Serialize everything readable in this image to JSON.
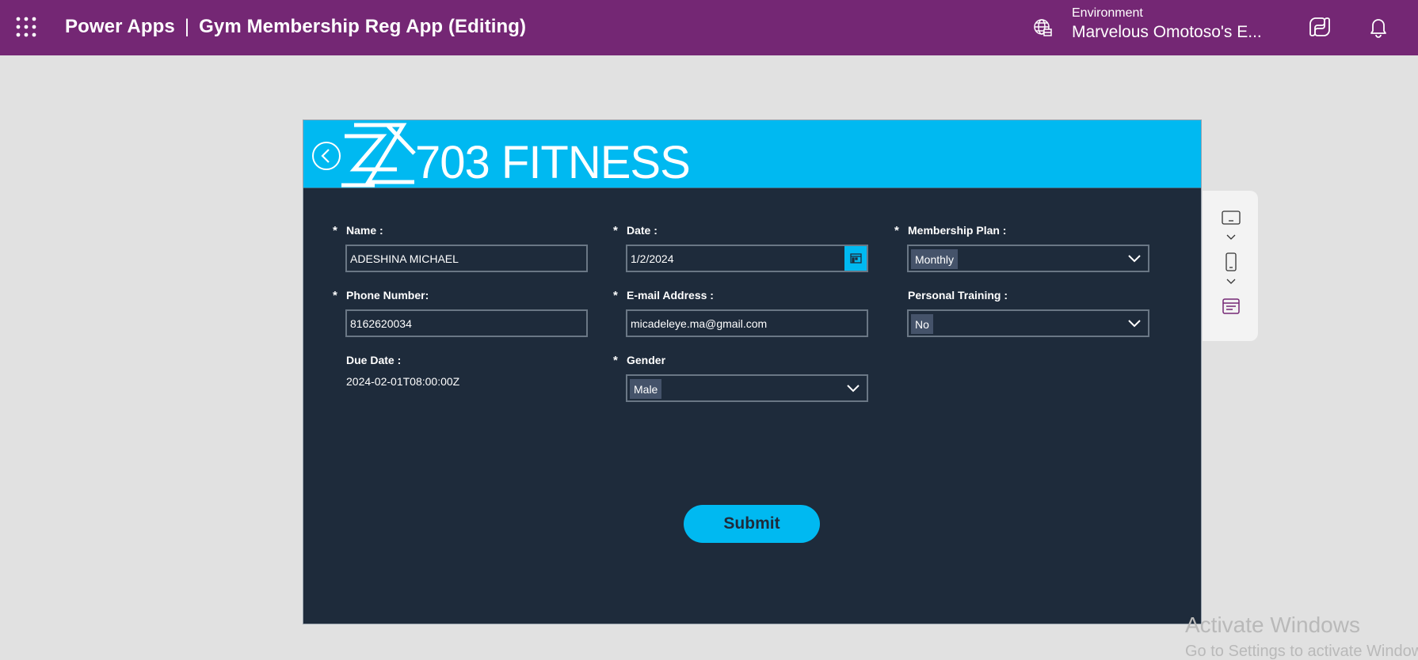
{
  "topbar": {
    "product": "Power Apps",
    "separator": "|",
    "app_name": "Gym Membership Reg App (Editing)",
    "environment_label": "Environment",
    "environment_name": "Marvelous Omotoso's E...",
    "color": "#742774"
  },
  "canvas": {
    "brand": "703 FITNESS",
    "header_color": "#00b9f1",
    "background": "#1e2b3b",
    "fields": {
      "name": {
        "label": "Name :",
        "required": "*",
        "value": "ADESHINA MICHAEL"
      },
      "date": {
        "label": "Date :",
        "required": "*",
        "value": "1/2/2024"
      },
      "membership_plan": {
        "label": "Membership Plan :",
        "required": "*",
        "value": "Monthly"
      },
      "phone": {
        "label": "Phone Number:",
        "required": "*",
        "value": "8162620034"
      },
      "email": {
        "label": "E-mail Address :",
        "required": "*",
        "value": "micadeleye.ma@gmail.com"
      },
      "personal_training": {
        "label": "Personal Training :",
        "value": "No"
      },
      "due_date": {
        "label": "Due Date :",
        "value": "2024-02-01T08:00:00Z"
      },
      "gender": {
        "label": "Gender",
        "required": "*",
        "value": "Male"
      }
    },
    "submit_label": "Submit"
  },
  "tool_panel": {
    "icons": [
      "tablet-layout-icon",
      "phone-layout-icon",
      "form-view-icon"
    ]
  },
  "watermark": {
    "line1": "Activate Windows",
    "line2": "Go to Settings to activate Windows."
  }
}
